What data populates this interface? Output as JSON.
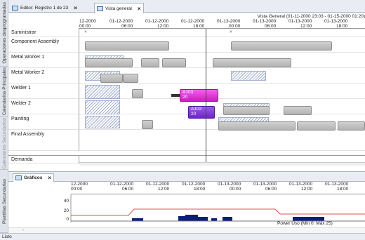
{
  "sidebar": {
    "tabs": [
      {
        "label": "Operaciones desprogramadas",
        "dim": false
      },
      {
        "label": "Calendarios Principales",
        "dim": false
      },
      {
        "label": "Calendarios Secundarios",
        "dim": true
      },
      {
        "label": "Plantillas Secundarias",
        "dim": false
      }
    ]
  },
  "tabs": [
    {
      "label": "Editor: Registro 1 de 23",
      "close": "×",
      "icon": "table-icon"
    },
    {
      "label": "Vista general",
      "close": "×",
      "icon": "chart-icon"
    }
  ],
  "gantt": {
    "title": "Vista General   (01-11-2000 23:03 - 01-15-2000 01:20)",
    "ticks": [
      {
        "date": "12-2000",
        "time": "00:00"
      },
      {
        "date": "01-12-2000",
        "time": "06:00"
      },
      {
        "date": "01-12-2000",
        "time": "12:00"
      },
      {
        "date": "01-12-2000",
        "time": "18:00"
      },
      {
        "date": "01-13-2000",
        "time": "00:00"
      },
      {
        "date": "01-13-2000",
        "time": "06:00"
      },
      {
        "date": "01-13-2000",
        "time": "12:00"
      },
      {
        "date": "01-13-2000",
        "time": "18:00"
      }
    ],
    "rows": [
      "Suministrar",
      "Component Assembly",
      "Metal Worker 1",
      "Metal Worker 2",
      "Welder 1",
      "Welder 2",
      "Painting",
      "Final Assembly",
      "Demanda"
    ],
    "bar_labels": {
      "A103": "A103",
      "A103_sub": "20",
      "A102": "A102",
      "A102_sub": "20",
      "small": "A103"
    }
  },
  "graficos": {
    "tab_label": "Gráficos",
    "tab_close": "×",
    "ticks": [
      {
        "date": "12-2000",
        "time": "00:00"
      },
      {
        "date": "01-12-2000",
        "time": "06:00"
      },
      {
        "date": "01-12-2000",
        "time": "12:00"
      },
      {
        "date": "01-12-2000",
        "time": "18:00"
      },
      {
        "date": "01-13-2000",
        "time": "00:00"
      },
      {
        "date": "01-13-2000",
        "time": "06:00"
      },
      {
        "date": "01-13-2000",
        "time": "12:00"
      },
      {
        "date": "01-13-2000",
        "time": "18:00"
      }
    ],
    "y_ticks": [
      "40",
      "20",
      "0"
    ],
    "legend": "Power Uso (Min 0: Máx 25)",
    "colors": {
      "capacity_line": "#d9534f",
      "usage_bars": "#0b1f7a"
    }
  },
  "status_text": "Listo"
}
